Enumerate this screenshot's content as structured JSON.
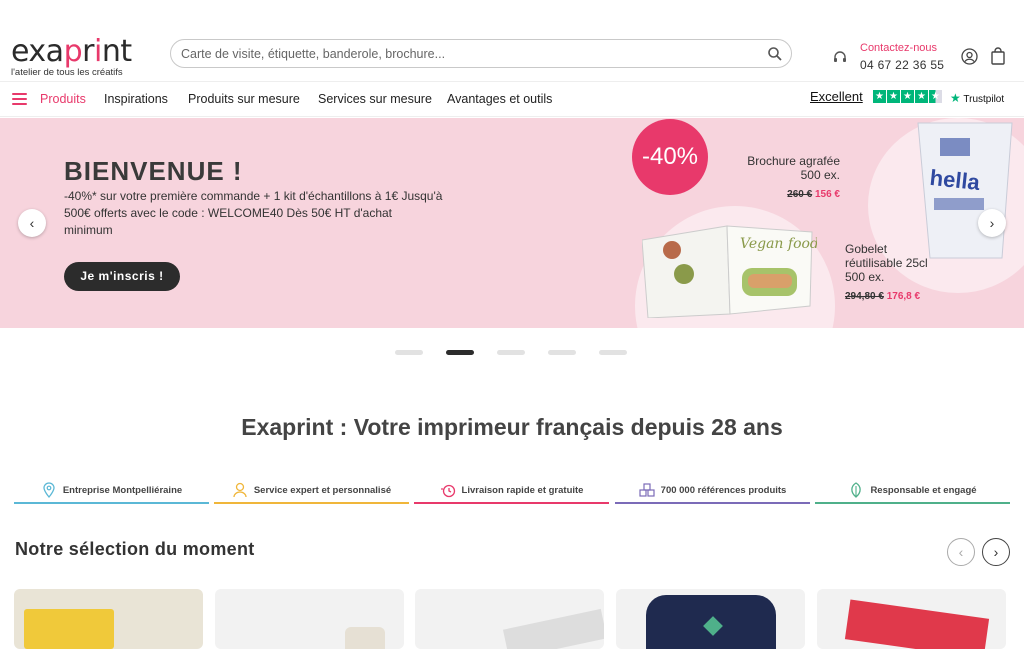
{
  "header": {
    "logo_text": "exaprint",
    "logo_tagline": "l'atelier de tous les créatifs",
    "search_placeholder": "Carte de visite, étiquette, banderole, brochure...",
    "contact_label": "Contactez-nous",
    "contact_phone": "04 67 22 36 55"
  },
  "nav": {
    "items": [
      "Produits",
      "Inspirations",
      "Produits sur mesure",
      "Services sur mesure",
      "Avantages et outils"
    ],
    "trustpilot_rating": "Excellent",
    "trustpilot_brand": "Trustpilot",
    "trustpilot_color": "#00b67a"
  },
  "hero": {
    "title": "BIENVENUE !",
    "text": "-40%* sur votre première commande + 1 kit d'échantillons à 1€ Jusqu'à 500€ offerts avec le code : WELCOME40 Dès 50€ HT d'achat minimum",
    "cta": "Je m'inscris !",
    "discount": "-40%",
    "promo_a": {
      "name": "Brochure agrafée",
      "qty": "500 ex.",
      "old_price": "260 €",
      "new_price": "156 €"
    },
    "promo_b": {
      "name": "Gobelet réutilisable 25cl",
      "qty": "500 ex.",
      "old_price": "294,80 €",
      "new_price": "176,8 €"
    },
    "brochure_text": "Vegan food",
    "cup_text": "hella",
    "bg_color": "#f7d4dd",
    "accent": "#e8396b"
  },
  "carousel": {
    "slides": 5,
    "active": 2
  },
  "section_title": "Exaprint : Votre imprimeur français depuis 28 ans",
  "features": [
    {
      "label": "Entreprise Montpelliéraine",
      "icon": "location-pin-icon",
      "color": "#5bb8d6"
    },
    {
      "label": "Service expert et personnalisé",
      "icon": "expert-user-icon",
      "color": "#f0b63a"
    },
    {
      "label": "Livraison rapide et gratuite",
      "icon": "fast-delivery-icon",
      "color": "#e8396b"
    },
    {
      "label": "700 000 références produits",
      "icon": "cubes-icon",
      "color": "#7b6bb8"
    },
    {
      "label": "Responsable et engagé",
      "icon": "leaf-icon",
      "color": "#4fb08a"
    }
  ],
  "selection_title": "Notre sélection du moment"
}
